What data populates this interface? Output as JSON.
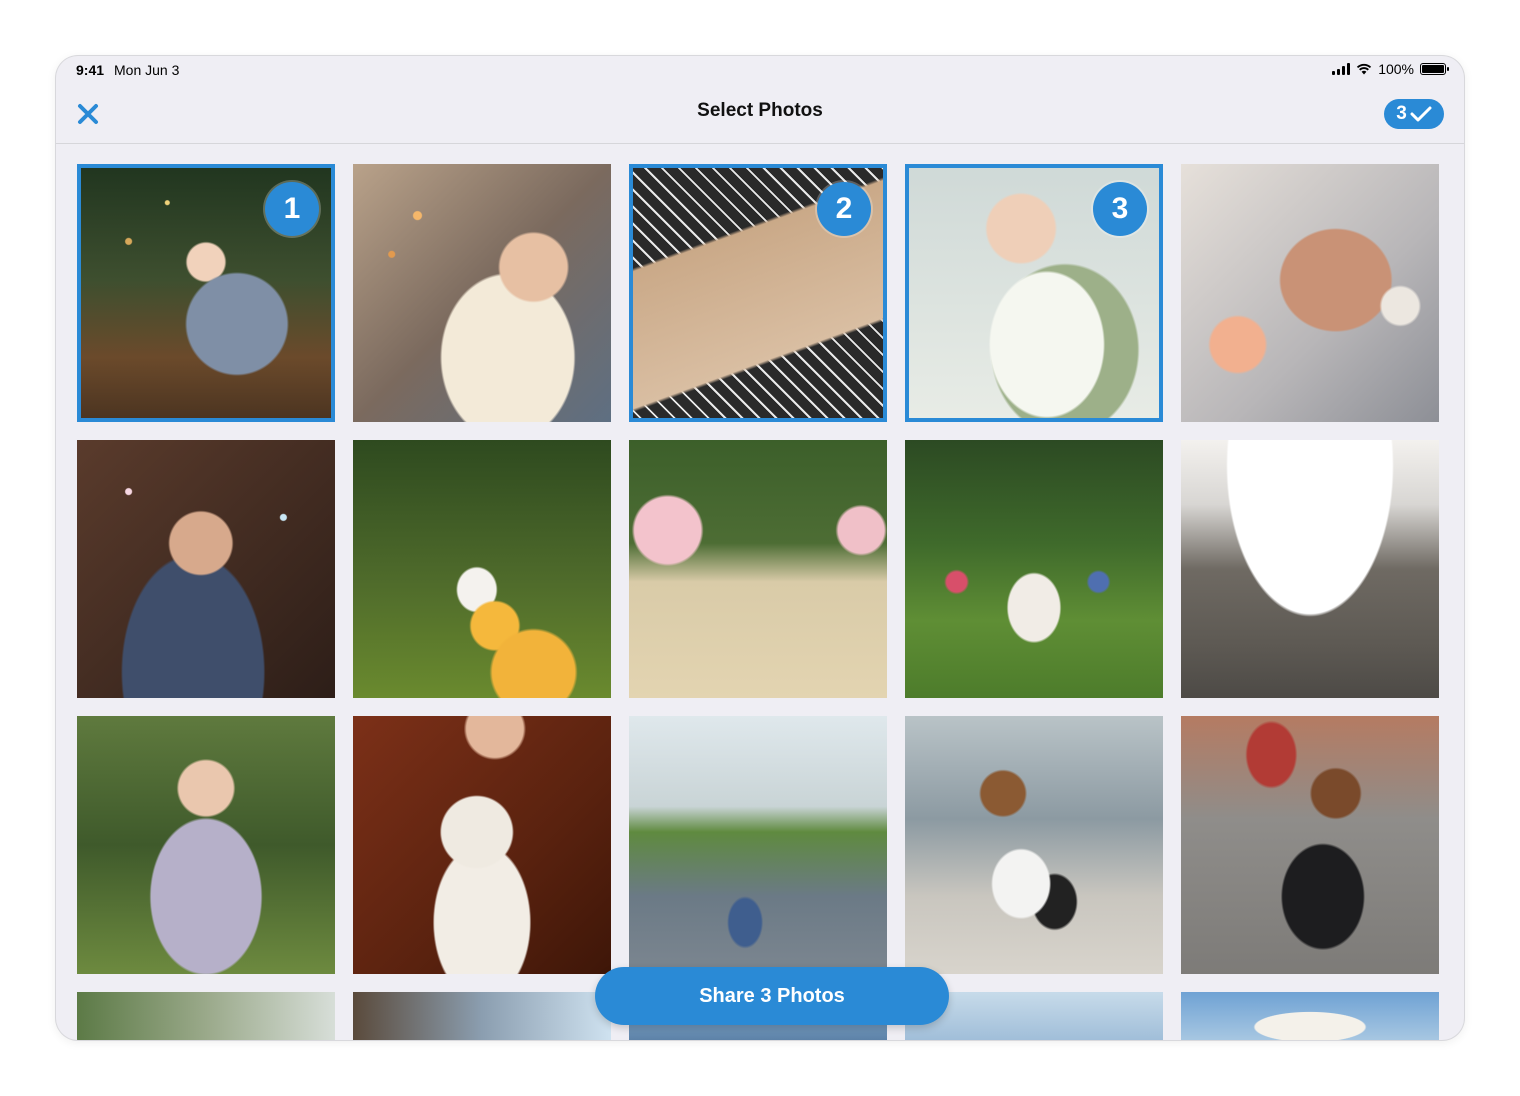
{
  "status": {
    "time": "9:41",
    "date": "Mon Jun 3",
    "battery": "100%"
  },
  "nav": {
    "title": "Select Photos",
    "selected_count": "3"
  },
  "share_button": "Share 3 Photos",
  "colors": {
    "accent": "#2a8ad6",
    "background": "#efeef4"
  },
  "photos": [
    {
      "subject": "toddler by christmas tree",
      "selected": true,
      "order": "1"
    },
    {
      "subject": "father hugging daughter",
      "selected": false,
      "order": ""
    },
    {
      "subject": "wrapped gift box",
      "selected": true,
      "order": "2"
    },
    {
      "subject": "bride with bouquet",
      "selected": true,
      "order": "3"
    },
    {
      "subject": "holding hands with watch",
      "selected": false,
      "order": ""
    },
    {
      "subject": "groom with confetti",
      "selected": false,
      "order": ""
    },
    {
      "subject": "girl with yellow balloons",
      "selected": false,
      "order": ""
    },
    {
      "subject": "wedding aisle with flowers",
      "selected": false,
      "order": ""
    },
    {
      "subject": "bride at garden party",
      "selected": false,
      "order": ""
    },
    {
      "subject": "bride shoes on steps",
      "selected": false,
      "order": ""
    },
    {
      "subject": "girl with flower crown",
      "selected": false,
      "order": ""
    },
    {
      "subject": "girl holding white cat",
      "selected": false,
      "order": ""
    },
    {
      "subject": "mother and child walking",
      "selected": false,
      "order": ""
    },
    {
      "subject": "mother and daughter on street",
      "selected": false,
      "order": ""
    },
    {
      "subject": "mother hugging child on street",
      "selected": false,
      "order": ""
    },
    {
      "subject": "trees",
      "selected": false,
      "order": ""
    },
    {
      "subject": "city buildings",
      "selected": false,
      "order": ""
    },
    {
      "subject": "city",
      "selected": false,
      "order": ""
    },
    {
      "subject": "sky",
      "selected": false,
      "order": ""
    },
    {
      "subject": "clouds",
      "selected": false,
      "order": ""
    }
  ]
}
